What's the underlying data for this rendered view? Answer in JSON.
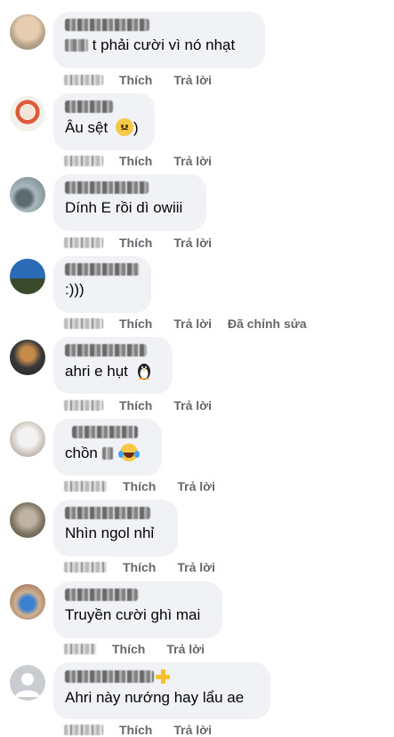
{
  "comments": [
    {
      "text": "t phải cười vì nó nhạt",
      "like": "Thích",
      "reply": "Trả lời"
    },
    {
      "text": "Âu sệt",
      "suffix": ")",
      "like": "Thích",
      "reply": "Trả lời",
      "emoji": "sad-face-emoji"
    },
    {
      "text": "Dính E rồi dì owiii",
      "like": "Thích",
      "reply": "Trả lời"
    },
    {
      "text": ":)))",
      "like": "Thích",
      "reply": "Trả lời",
      "edited": "Đã chỉnh sửa"
    },
    {
      "text": "ahri e hụt",
      "like": "Thích",
      "reply": "Trả lời",
      "emoji": "penguin-emoji"
    },
    {
      "text": "chồn",
      "like": "Thích",
      "reply": "Trả lời",
      "emoji": "laughing-tears-emoji"
    },
    {
      "text": "Nhìn ngol nhỉ",
      "like": "Thích",
      "reply": "Trả lời"
    },
    {
      "text": "Truyền cười ghì mai",
      "like": "Thích",
      "reply": "Trả lời"
    },
    {
      "text": "Ahri này nướng hay lẩu ae",
      "like": "Thích",
      "reply": "Trả lời",
      "badge": "plus-icon"
    }
  ],
  "colors": {
    "bubble": "#f0f2f5",
    "meta": "#65676b",
    "text": "#050505",
    "badge": "#f5c02b"
  }
}
